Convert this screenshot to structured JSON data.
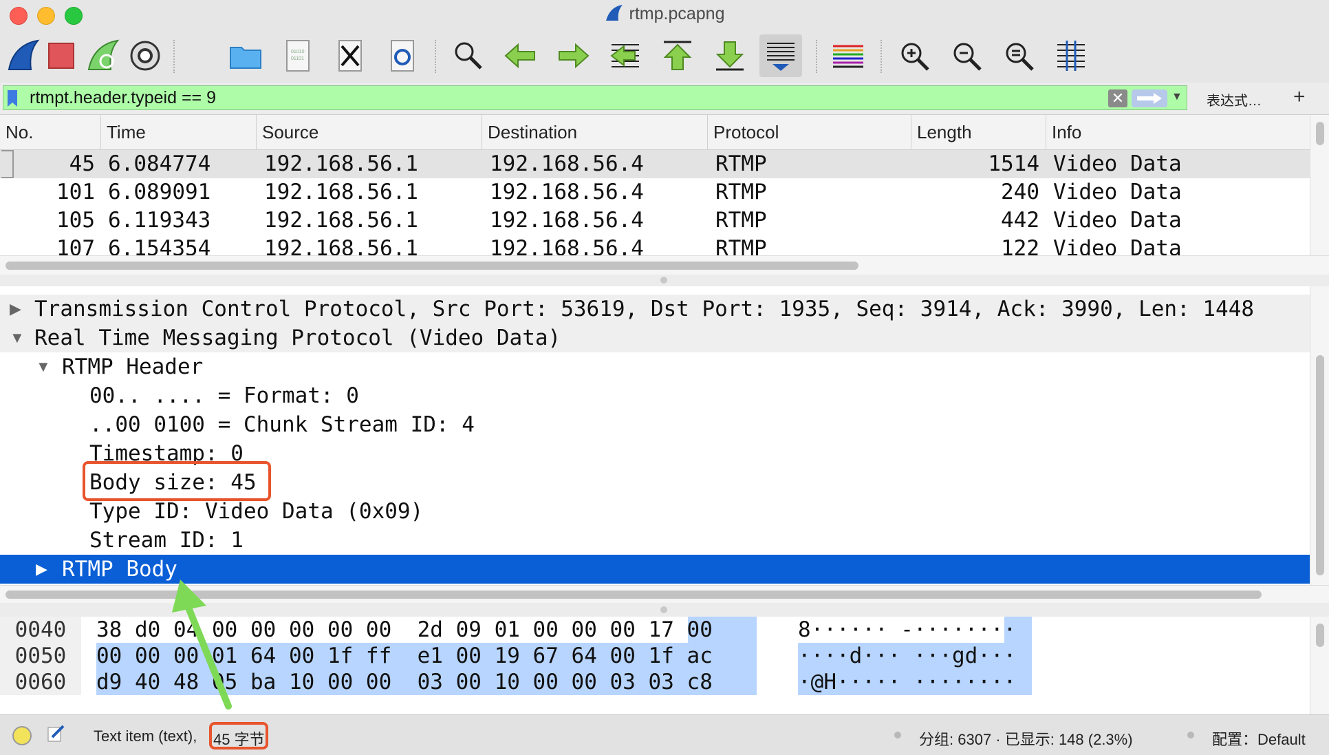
{
  "window": {
    "title": "rtmp.pcapng"
  },
  "colors": {
    "filter_bg": "#aefca8",
    "selection": "#0a5fd6",
    "highlight_box": "#e8542c",
    "arrow": "#7ed957",
    "byte_highlight": "#b7d5ff"
  },
  "toolbar": {
    "icons": [
      "start-capture-icon",
      "stop-capture-icon",
      "restart-capture-icon",
      "capture-options-icon",
      "open-file-icon",
      "save-file-icon",
      "close-file-icon",
      "reload-file-icon",
      "find-packet-icon",
      "go-back-icon",
      "go-forward-icon",
      "go-to-packet-icon",
      "go-first-icon",
      "go-last-icon",
      "autoscroll-icon",
      "colorize-icon",
      "zoom-in-icon",
      "zoom-out-icon",
      "zoom-reset-icon",
      "resize-columns-icon"
    ]
  },
  "filter": {
    "value": "rtmpt.header.typeid == 9",
    "expression_label": "表达式…",
    "add_label": "+"
  },
  "packet_list": {
    "columns": [
      "No.",
      "Time",
      "Source",
      "Destination",
      "Protocol",
      "Length",
      "Info"
    ],
    "rows": [
      {
        "no": "45",
        "time": "6.084774",
        "source": "192.168.56.1",
        "destination": "192.168.56.4",
        "protocol": "RTMP",
        "length": "1514",
        "info": "Video Data"
      },
      {
        "no": "101",
        "time": "6.089091",
        "source": "192.168.56.1",
        "destination": "192.168.56.4",
        "protocol": "RTMP",
        "length": "240",
        "info": "Video Data"
      },
      {
        "no": "105",
        "time": "6.119343",
        "source": "192.168.56.1",
        "destination": "192.168.56.4",
        "protocol": "RTMP",
        "length": "442",
        "info": "Video Data"
      },
      {
        "no": "107",
        "time": "6.154354",
        "source": "192.168.56.1",
        "destination": "192.168.56.4",
        "protocol": "RTMP",
        "length": "122",
        "info": "Video Data"
      }
    ]
  },
  "details": {
    "tcp": "Transmission Control Protocol, Src Port: 53619, Dst Port: 1935, Seq: 3914, Ack: 3990, Len: 1448",
    "rtmp": "Real Time Messaging Protocol (Video Data)",
    "header": "RTMP Header",
    "format": "00.. .... = Format: 0",
    "chunk_stream": "..00 0100 = Chunk Stream ID: 4",
    "timestamp": "Timestamp: 0",
    "body_size": "Body size: 45",
    "type_id": "Type ID: Video Data (0x09)",
    "stream_id": "Stream ID: 1",
    "body": "RTMP Body"
  },
  "bytes": {
    "rows": [
      {
        "offset": "0040",
        "hex": "38 d0 04 00 00 00 00 00  2d 09 01 00 00 00 17 00",
        "ascii": "8······ -········"
      },
      {
        "offset": "0050",
        "hex": "00 00 00 01 64 00 1f ff  e1 00 19 67 64 00 1f ac",
        "ascii": "····d··· ···gd···"
      },
      {
        "offset": "0060",
        "hex": "d9 40 48 05 ba 10 00 00  03 00 10 00 00 03 03 c8",
        "ascii": "·@H····· ········"
      }
    ]
  },
  "status": {
    "item_text": "Text item (text),",
    "bytes_text": "45 字节",
    "packets_text": "分组: 6307 · 已显示: 148 (2.3%)",
    "profile_text": "配置：Default"
  }
}
